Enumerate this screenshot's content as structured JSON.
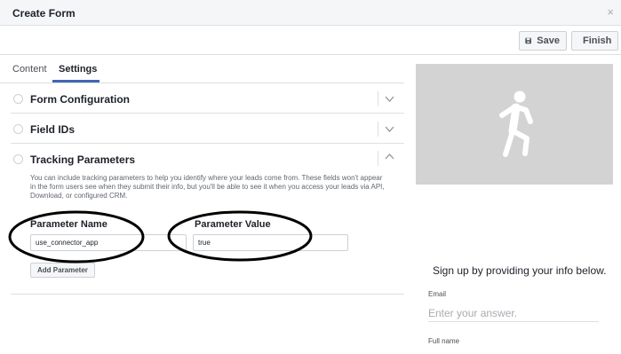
{
  "window": {
    "title": "Create Form",
    "close_glyph": "×"
  },
  "toolbar": {
    "save_label": "Save",
    "finish_label": "Finish"
  },
  "tabs": [
    {
      "label": "Content",
      "active": false
    },
    {
      "label": "Settings",
      "active": true
    }
  ],
  "sections": {
    "form_configuration": {
      "title": "Form Configuration",
      "expanded": false
    },
    "field_ids": {
      "title": "Field IDs",
      "expanded": false
    },
    "tracking_parameters": {
      "title": "Tracking Parameters",
      "expanded": true,
      "description": "You can include tracking parameters to help you identify where your leads come from. These fields won't appear in the form users see when they submit their info, but you'll be able to see it when you access your leads via API, Download, or configured CRM.",
      "name_header": "Parameter Name",
      "value_header": "Parameter Value",
      "param_name": "use_connector_app",
      "param_value": "true",
      "add_label": "Add Parameter"
    }
  },
  "preview": {
    "heading": "Sign up by providing your info below.",
    "email_label": "Email",
    "email_placeholder": "Enter your answer.",
    "fullname_label": "Full name"
  },
  "colors": {
    "accent": "#4267b2",
    "annotation": "#000000",
    "hero": "#d3d3d3"
  },
  "icons": [
    "close-icon",
    "save-icon",
    "finish-icon",
    "chevron-down-icon",
    "chevron-up-icon",
    "running-person-icon"
  ]
}
